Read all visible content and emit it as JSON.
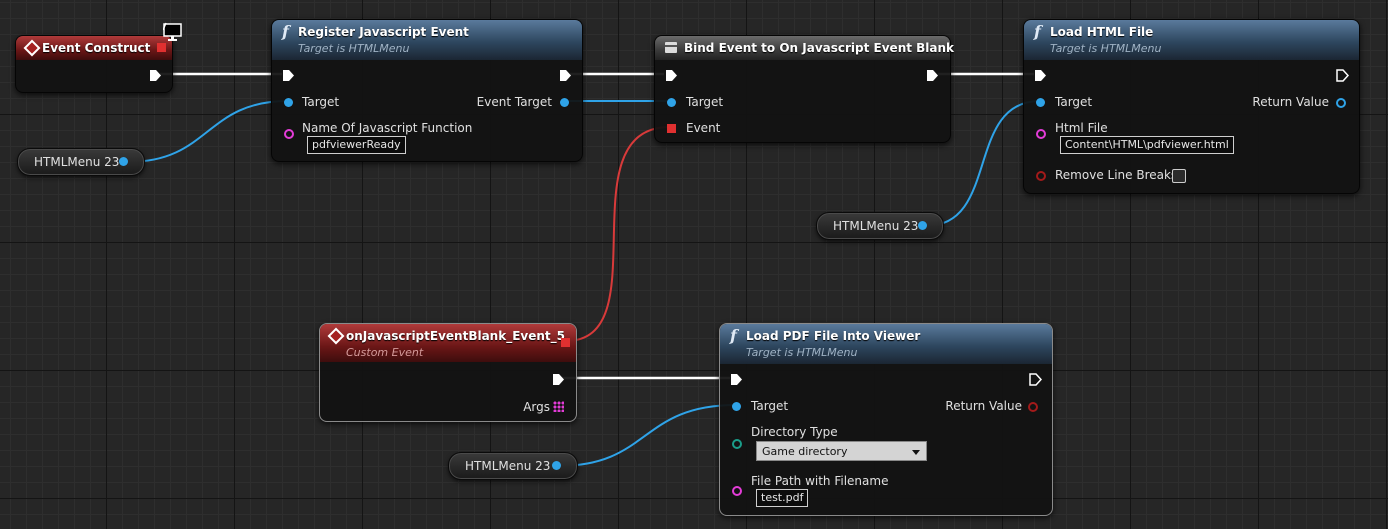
{
  "nodes": {
    "event_construct": {
      "title": "Event Construct"
    },
    "register_js_event": {
      "title": "Register Javascript Event",
      "subtitle": "Target is HTMLMenu",
      "pin_target": "Target",
      "pin_event_target": "Event Target",
      "pin_function_name": "Name Of Javascript Function",
      "function_name_value": "pdfviewerReady"
    },
    "bind_event": {
      "title": "Bind Event to On Javascript Event Blank",
      "pin_target": "Target",
      "pin_event": "Event"
    },
    "load_html_file": {
      "title": "Load HTML File",
      "subtitle": "Target is HTMLMenu",
      "pin_target": "Target",
      "pin_return": "Return Value",
      "pin_html_file": "Html File",
      "html_file_value": "Content\\HTML\\pdfviewer.html",
      "pin_remove_line_breaks": "Remove Line Breaks"
    },
    "custom_event": {
      "title": "onJavascriptEventBlank_Event_5",
      "subtitle": "Custom Event",
      "pin_args": "Args"
    },
    "load_pdf": {
      "title": "Load PDF File Into Viewer",
      "subtitle": "Target is HTMLMenu",
      "pin_target": "Target",
      "pin_return": "Return Value",
      "pin_directory_type": "Directory Type",
      "directory_type_value": "Game directory",
      "pin_file_path": "File Path with Filename",
      "file_path_value": "test.pdf"
    }
  },
  "variables": {
    "htmlmenu_1": "HTMLMenu 23",
    "htmlmenu_2": "HTMLMenu 23",
    "htmlmenu_3": "HTMLMenu 23"
  },
  "colors": {
    "exec_wire": "#ffffff",
    "object_wire": "#2fa3e8",
    "delegate_wire": "#d83a3a",
    "function_header": "#2e475f",
    "event_header": "#6a1616"
  },
  "icons": {
    "function": "f",
    "event": "diamond",
    "bind": "bind-event",
    "monitor": "monitor-icon"
  }
}
